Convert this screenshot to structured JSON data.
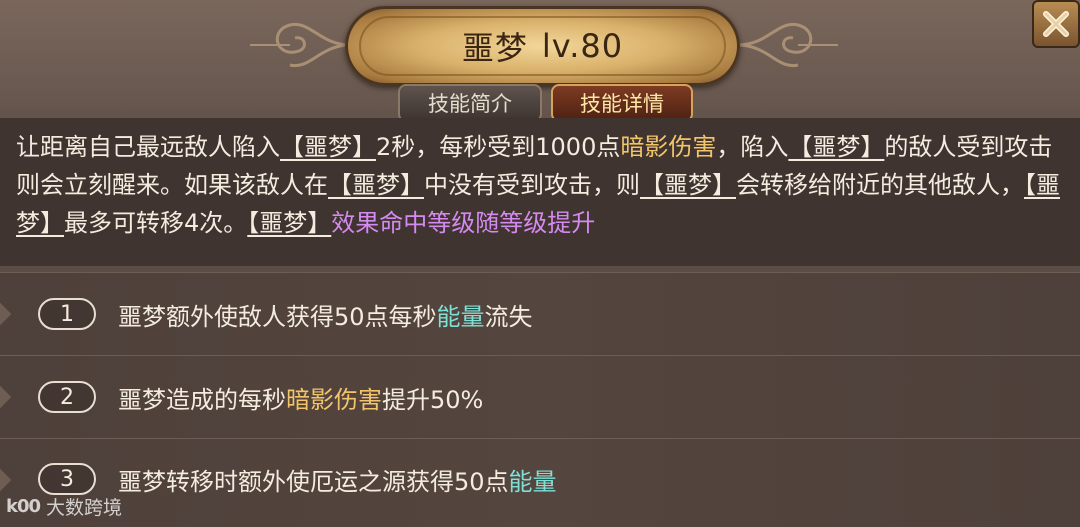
{
  "skill": {
    "name": "噩梦",
    "level": "lv.80"
  },
  "tabs": {
    "intro": "技能简介",
    "detail": "技能详情"
  },
  "description": {
    "s1": "让距离自己最远敌人陷入",
    "kw1": "【噩梦】",
    "s2": "2秒，每秒受到1000点",
    "dmg": "暗影伤害",
    "s3": "，陷入",
    "kw2": "【噩梦】",
    "s4": "的敌人受到攻击则会立刻醒来。如果该敌人在",
    "kw3": "【噩梦】",
    "s5": "中没有受到攻击，则",
    "kw4": "【噩梦】",
    "s6": "会转移给附近的其他敌人，",
    "kw5": "【噩梦】",
    "s7": "最多可转移4次。",
    "kw6": "【噩梦】",
    "hit": "效果命中等级随等级提升"
  },
  "upgrades": [
    {
      "num": "1",
      "pre": "噩梦额外使敌人获得50点每秒",
      "kw": "能量",
      "post": "流失"
    },
    {
      "num": "2",
      "pre": "噩梦造成的每秒",
      "kw": "暗影伤害",
      "post": "提升50%"
    },
    {
      "num": "3",
      "pre": "噩梦转移时额外使厄运之源获得50点",
      "kw": "能量",
      "post": ""
    }
  ],
  "watermark": {
    "logo": "k00",
    "text": "大数跨境"
  },
  "colors": {
    "damage_keyword": "#f3c56b",
    "energy_keyword": "#7fe0d6",
    "hit_text": "#d58af0",
    "active_tab": "#ffe7a8"
  },
  "icons": {
    "close": "close-icon",
    "title_ornament": "scroll-ornament-icon"
  }
}
